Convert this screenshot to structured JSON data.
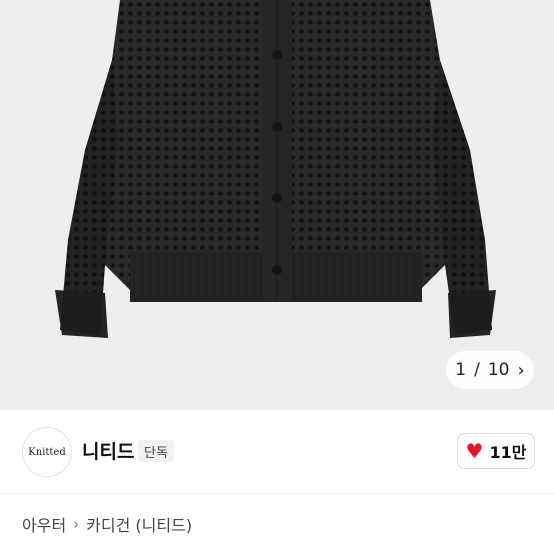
{
  "gallery": {
    "current": "1",
    "separator": "/",
    "total": "10",
    "next_icon": "chevron-right-icon",
    "sweater_color": "#2a2a2a"
  },
  "shop": {
    "logo_text": "Knitted",
    "name": "니티드",
    "badge": "단독",
    "likes": "11만",
    "like_icon": "heart-icon",
    "heart_color": "#e5142c"
  },
  "breadcrumb": {
    "items": [
      "아우터",
      "카디건 (니티드)"
    ],
    "separator_icon": "chevron-right-icon"
  }
}
